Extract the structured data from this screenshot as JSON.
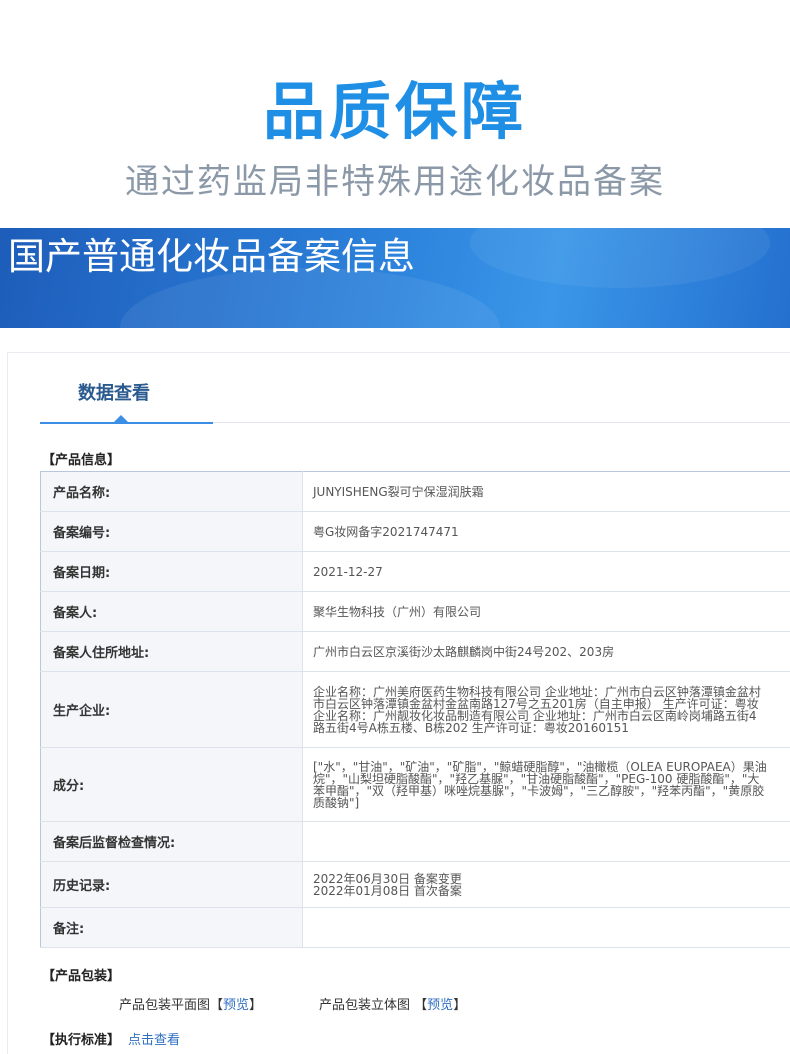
{
  "hero": {
    "title": "品质保障",
    "subtitle": "通过药监局非特殊用途化妆品备案"
  },
  "banner": {
    "title": "国产普通化妆品备案信息"
  },
  "tabs": {
    "active_label": "数据查看"
  },
  "product_info": {
    "section_title": "【产品信息】",
    "rows": [
      {
        "label": "产品名称:",
        "value": [
          "JUNYISHENG裂可宁保湿润肤霜"
        ]
      },
      {
        "label": "备案编号:",
        "value": [
          "粤G妆网备字2021747471"
        ]
      },
      {
        "label": "备案日期:",
        "value": [
          "2021-12-27"
        ]
      },
      {
        "label": "备案人:",
        "value": [
          "聚华生物科技（广州）有限公司"
        ]
      },
      {
        "label": "备案人住所地址:",
        "value": [
          "广州市白云区京溪街沙太路麒麟岗中街24号202、203房"
        ]
      },
      {
        "label": "生产企业:",
        "value": [
          "企业名称：广州美府医药生物科技有限公司 企业地址：广州市白云区钟落潭镇金盆村",
          "市白云区钟落潭镇金盆村金盆南路127号之五201房（自主申报） 生产许可证：粤妆",
          "企业名称：广州靓妆化妆品制造有限公司 企业地址：广州市白云区南岭岗埔路五街4",
          "路五街4号A栋五楼、B栋202 生产许可证：粤妆20160151"
        ]
      },
      {
        "label": "成分:",
        "value": [
          "[\"水\"，\"甘油\"，\"矿油\"，\"矿脂\"，\"鲸蜡硬脂醇\"，\"油橄榄（OLEA EUROPAEA）果油",
          "烷\"，\"山梨坦硬脂酸酯\"，\"羟乙基脲\"，\"甘油硬脂酸酯\"，\"PEG-100 硬脂酸酯\"，\"大",
          "苯甲酯\"，\"双（羟甲基）咪唑烷基脲\"，\"卡波姆\"，\"三乙醇胺\"，\"羟苯丙酯\"，\"黄原胶",
          "质酸钠\"]"
        ]
      },
      {
        "label": "备案后监督检查情况:",
        "value": [
          ""
        ]
      },
      {
        "label": "历史记录:",
        "value": [
          "2022年06月30日 备案变更",
          "2022年01月08日 首次备案"
        ]
      },
      {
        "label": "备注:",
        "value": [
          ""
        ]
      }
    ]
  },
  "packaging": {
    "section_title": "【产品包装】",
    "plan_label": "产品包装平面图",
    "solid_label": "产品包装立体图",
    "bracket_open": "【",
    "bracket_close": "】",
    "preview_label": "预览"
  },
  "standard": {
    "section_title": "【执行标准】",
    "link_label": "点击查看"
  },
  "colors": {
    "hero_title": "#1f8fe6",
    "hero_subtitle": "#8b98a7",
    "banner": "#2a7fd9",
    "tab_text": "#2b5a8f",
    "link": "#2f6fc1"
  }
}
